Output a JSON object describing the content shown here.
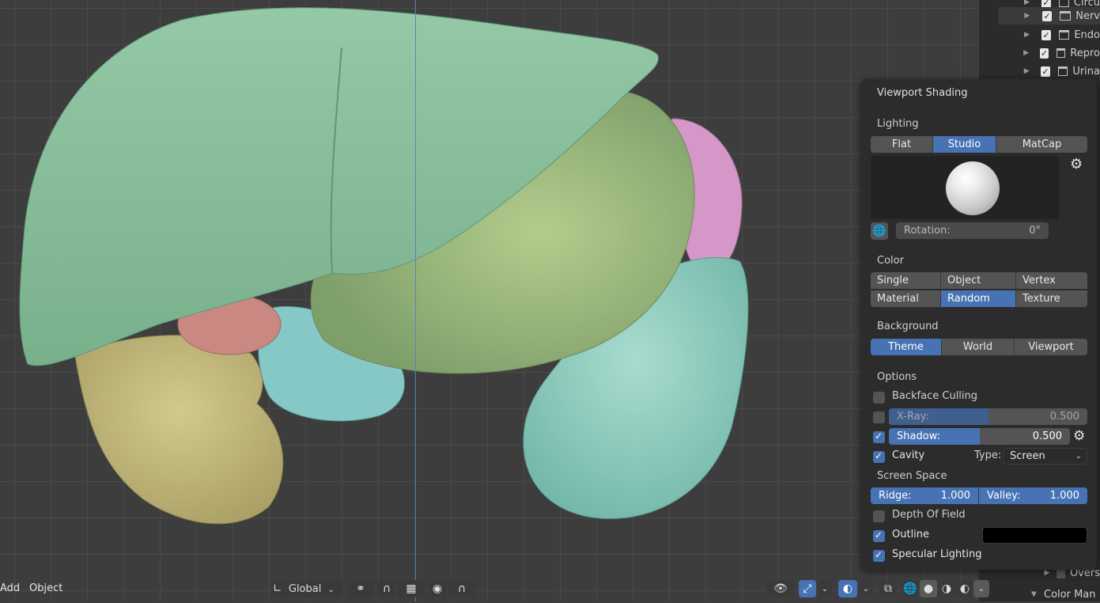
{
  "colors": {
    "accent": "#4772b3",
    "viewport_bg": "#3d3d3d",
    "popover_bg": "#2c2c2c",
    "button": "#545454",
    "outline_color": "#000000"
  },
  "outliner": {
    "items": [
      {
        "label": "Circu",
        "checked": true
      },
      {
        "label": "Nerv",
        "checked": true
      },
      {
        "label": "Endo",
        "checked": true
      },
      {
        "label": "Repro",
        "checked": true
      },
      {
        "label": "Urina",
        "checked": true
      }
    ],
    "partial_items": [
      {
        "label": "Overs"
      },
      {
        "label": "Color Man"
      }
    ]
  },
  "popover": {
    "title": "Viewport Shading",
    "lighting": {
      "label": "Lighting",
      "options": [
        "Flat",
        "Studio",
        "MatCap"
      ],
      "selected": "Studio",
      "rotation_label": "Rotation:",
      "rotation_value": "0°",
      "settings_icon": "gear-icon",
      "world_icon": "globe-icon"
    },
    "color": {
      "label": "Color",
      "options": [
        "Single",
        "Object",
        "Vertex",
        "Material",
        "Random",
        "Texture"
      ],
      "selected": "Random"
    },
    "background": {
      "label": "Background",
      "options": [
        "Theme",
        "World",
        "Viewport"
      ],
      "selected": "Theme"
    },
    "options": {
      "label": "Options",
      "backface_culling": {
        "label": "Backface Culling",
        "checked": false
      },
      "xray": {
        "label": "X-Ray:",
        "value": "0.500",
        "fraction": 0.5,
        "checked": false
      },
      "shadow": {
        "label": "Shadow:",
        "value": "0.500",
        "fraction": 0.5,
        "checked": true
      },
      "cavity": {
        "label": "Cavity",
        "checked": true,
        "type_label": "Type:",
        "type_value": "Screen"
      },
      "screen_space_label": "Screen Space",
      "ridge": {
        "label": "Ridge:",
        "value": "1.000"
      },
      "valley": {
        "label": "Valley:",
        "value": "1.000"
      },
      "depth_of_field": {
        "label": "Depth Of Field",
        "checked": false
      },
      "outline": {
        "label": "Outline",
        "checked": true
      },
      "specular": {
        "label": "Specular Lighting",
        "checked": true
      }
    }
  },
  "header": {
    "add_label": "Add",
    "object_label": "Object",
    "transform_orientation": "Global"
  }
}
